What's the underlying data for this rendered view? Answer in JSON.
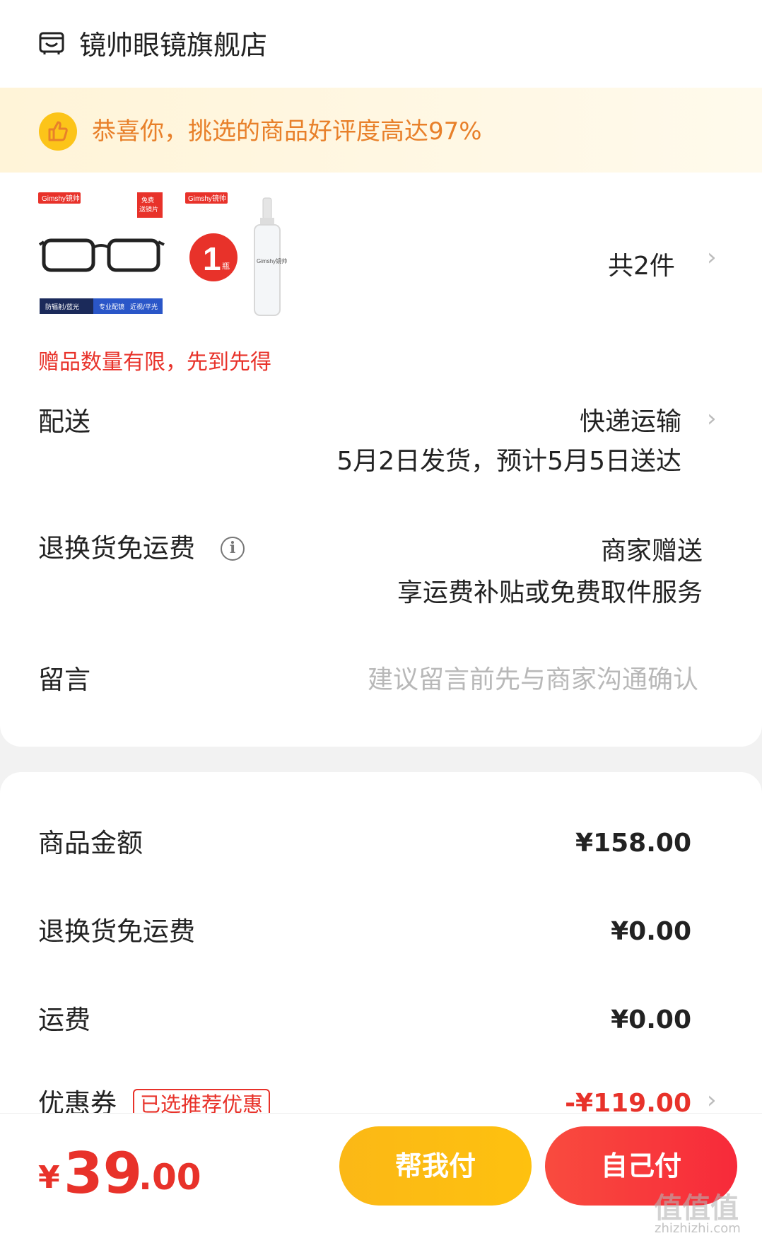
{
  "shop": {
    "name": "镜帅眼镜旗舰店"
  },
  "banner": {
    "text": "恭喜你，挑选的商品好评度高达97%"
  },
  "products": {
    "item1": {
      "brand": "Gimshy镜帅",
      "tag": "免费送镜片",
      "feature1": "防辐射/蓝光",
      "feature2": "专业配镜",
      "feature3": "近视/平光"
    },
    "item2": {
      "brand": "Gimshy镜帅",
      "qty_badge": "1",
      "qty_unit": "瓶",
      "bottle_label": "Gimshy镜帅"
    },
    "total": "共2件",
    "gift_note": "赠品数量有限，先到先得"
  },
  "delivery": {
    "label": "配送",
    "method": "快递运输",
    "schedule": "5月2日发货，预计5月5日送达"
  },
  "return_fee": {
    "label": "退换货免运费",
    "value": "商家赠送",
    "desc": "享运费补贴或免费取件服务"
  },
  "message": {
    "label": "留言",
    "placeholder": "建议留言前先与商家沟通确认"
  },
  "summary": {
    "goods_label": "商品金额",
    "goods_value": "¥158.00",
    "return_label": "退换货免运费",
    "return_value": "¥0.00",
    "shipping_label": "运费",
    "shipping_value": "¥0.00",
    "coupon_label": "优惠券",
    "coupon_tag": "已选推荐优惠",
    "coupon_value": "-¥119.00"
  },
  "checkout": {
    "currency": "¥",
    "price_int": "39",
    "price_dec": ".00",
    "help_pay": "帮我付",
    "self_pay": "自己付"
  },
  "watermark": {
    "text": "值值值",
    "url": "zhizhizhi.com"
  },
  "colors": {
    "accent_red": "#e8322a",
    "banner_orange": "#e8802a",
    "help_yellow": "#fec10f"
  }
}
